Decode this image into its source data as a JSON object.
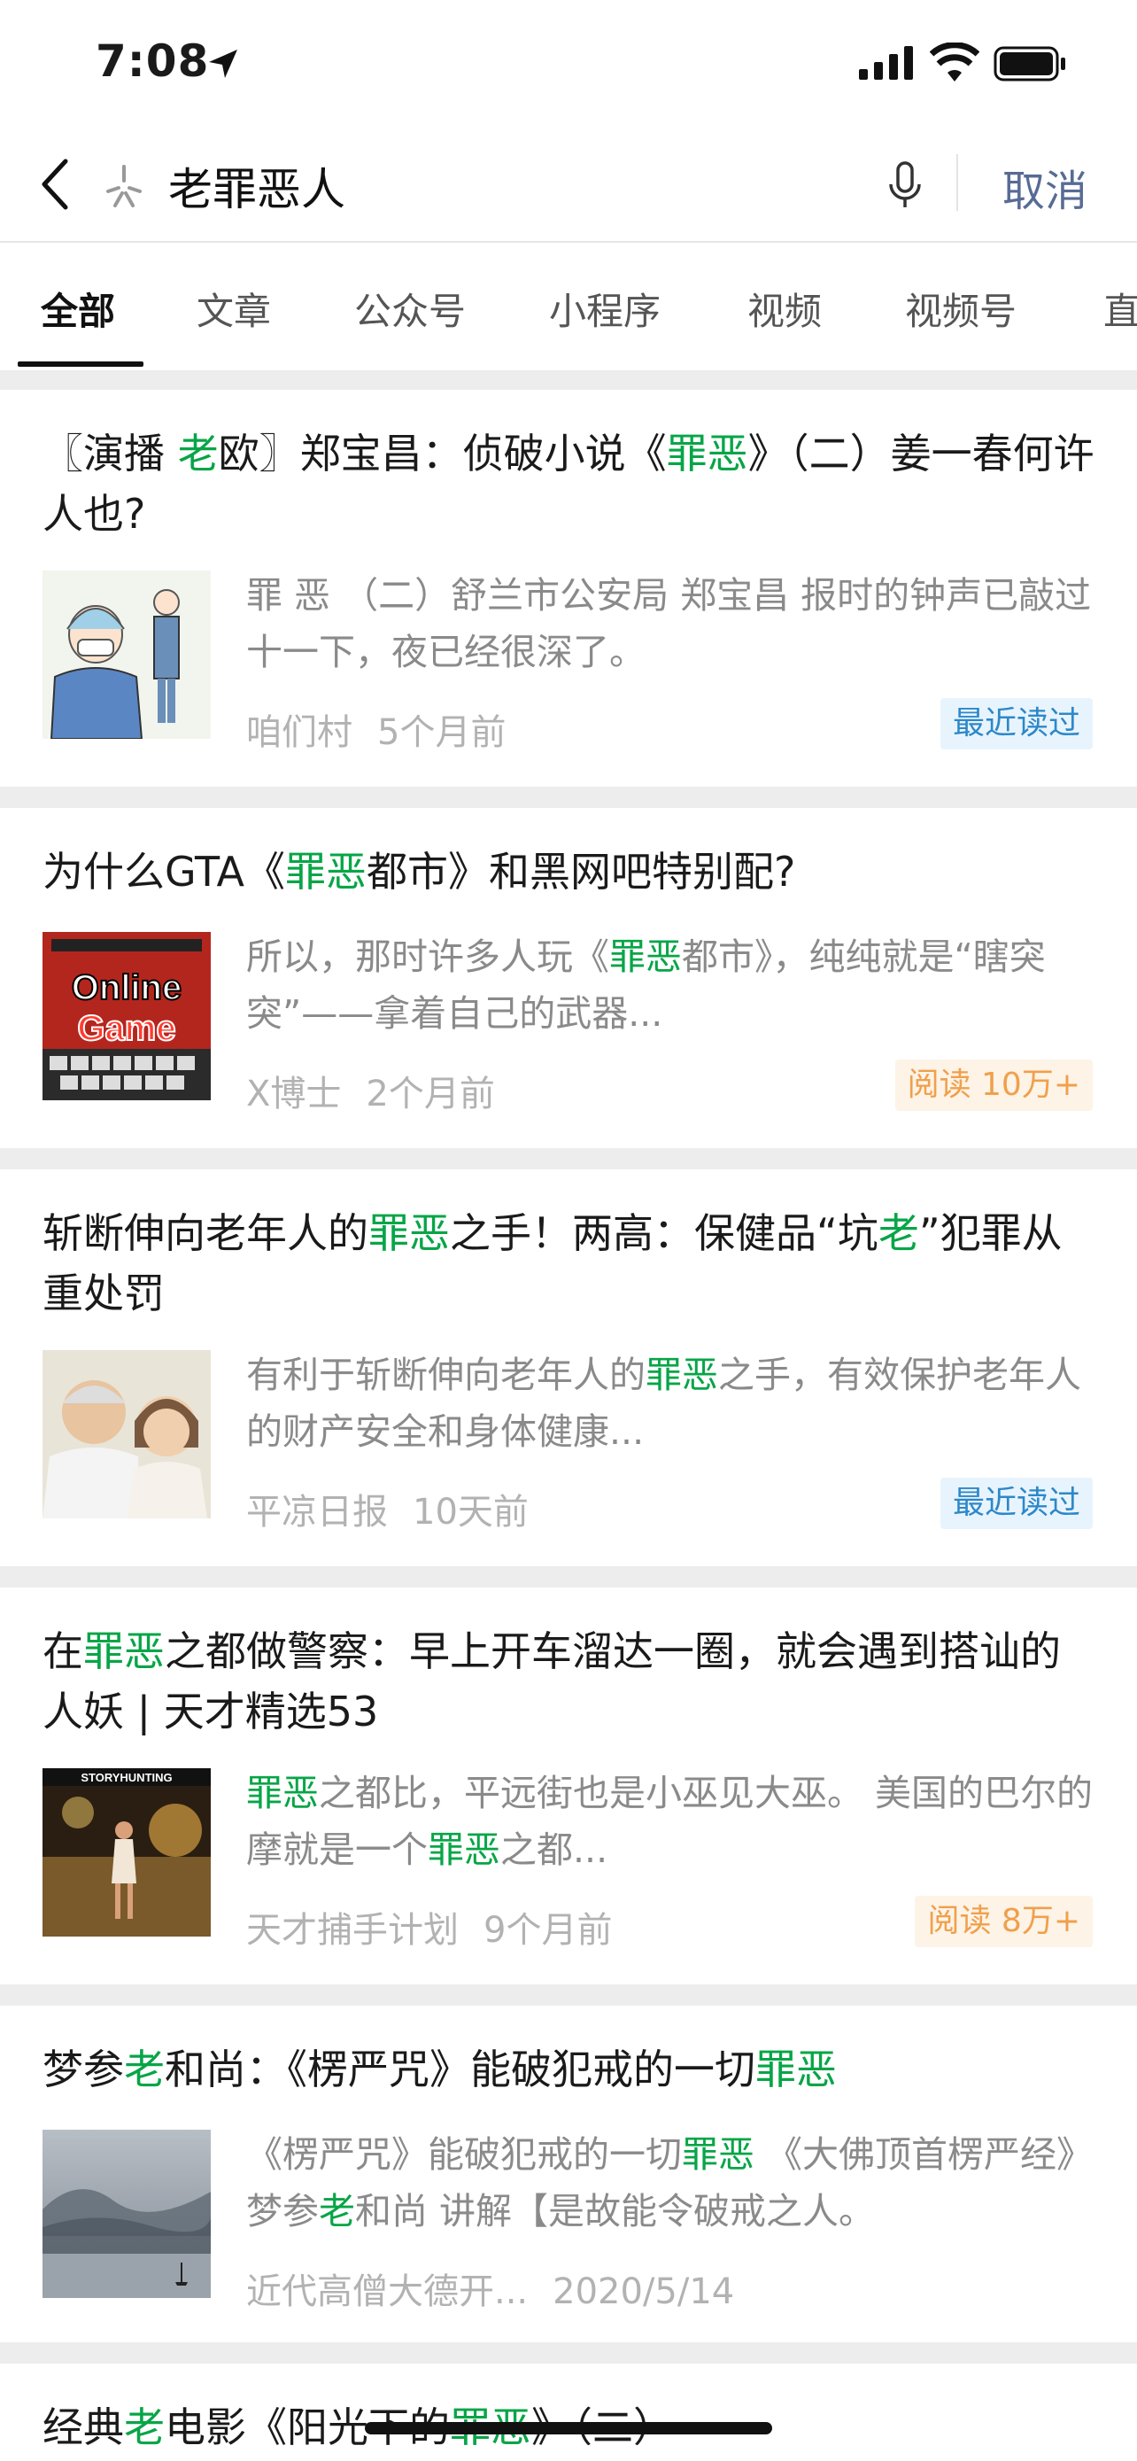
{
  "status_bar": {
    "time": "7:08"
  },
  "search": {
    "query": "老罪恶人",
    "cancel_label": "取消"
  },
  "tabs": [
    "全部",
    "文章",
    "公众号",
    "小程序",
    "视频",
    "视频号",
    "直"
  ],
  "results": [
    {
      "title_parts": [
        {
          "t": "〖演播 "
        },
        {
          "t": "老",
          "h": true
        },
        {
          "t": "欧〗郑宝昌：侦破小说《"
        },
        {
          "t": "罪恶",
          "h": true
        },
        {
          "t": "》（二）姜一春何许人也?"
        }
      ],
      "snippet_parts": [
        {
          "t": "罪 恶 （二）舒兰市公安局 郑宝昌 报时的钟声已敲过十一下，夜已经很深了。"
        }
      ],
      "source": "咱们村",
      "time": "5个月前",
      "badge": "最近读过",
      "badge_color": "#2d88c9"
    },
    {
      "title_parts": [
        {
          "t": "为什么GTA《"
        },
        {
          "t": "罪恶",
          "h": true
        },
        {
          "t": "都市》和黑网吧特别配?"
        }
      ],
      "snippet_parts": [
        {
          "t": "所以，那时许多人玩《"
        },
        {
          "t": "罪恶",
          "h": true
        },
        {
          "t": "都市》，纯纯就是“瞎突突”——拿着自己的武器..."
        }
      ],
      "source": "X博士",
      "time": "2个月前",
      "badge": "阅读 10万+",
      "badge_color": "#f0a04b",
      "thumb_text": [
        "Online",
        "Game"
      ]
    },
    {
      "title_parts": [
        {
          "t": "斩断伸向老年人的"
        },
        {
          "t": "罪恶",
          "h": true
        },
        {
          "t": "之手！两高：保健品“坑"
        },
        {
          "t": "老",
          "h": true
        },
        {
          "t": "”犯罪从重处罚"
        }
      ],
      "snippet_parts": [
        {
          "t": "有利于斩断伸向老年人的"
        },
        {
          "t": "罪恶",
          "h": true
        },
        {
          "t": "之手，有效保护老年人的财产安全和身体健康..."
        }
      ],
      "source": "平凉日报",
      "time": "10天前",
      "badge": "最近读过",
      "badge_color": "#2d88c9"
    },
    {
      "title_parts": [
        {
          "t": "在"
        },
        {
          "t": "罪恶",
          "h": true
        },
        {
          "t": "之都做警察：早上开车溜达一圈，就会遇到搭讪的人妖 | 天才精选53"
        }
      ],
      "snippet_parts": [
        {
          "t": "罪恶",
          "h": true
        },
        {
          "t": "之都比，平远街也是小巫见大巫。 美国的巴尔的摩就是一个"
        },
        {
          "t": "罪恶",
          "h": true
        },
        {
          "t": "之都..."
        }
      ],
      "source": "天才捕手计划",
      "time": "9个月前",
      "badge": "阅读 8万+",
      "badge_color": "#f0a04b",
      "thumb_text": [
        "STORYHUNTING"
      ]
    },
    {
      "title_parts": [
        {
          "t": "梦参"
        },
        {
          "t": "老",
          "h": true
        },
        {
          "t": "和尚：《楞严咒》能破犯戒的一切"
        },
        {
          "t": "罪恶",
          "h": true
        }
      ],
      "snippet_parts": [
        {
          "t": "《楞严咒》能破犯戒的一切"
        },
        {
          "t": "罪恶",
          "h": true
        },
        {
          "t": " 《大佛顶首楞严经》 梦参"
        },
        {
          "t": "老",
          "h": true
        },
        {
          "t": "和尚 讲解【是故能令破戒之人。"
        }
      ],
      "source": "近代高僧大德开...",
      "time": "2020/5/14",
      "badge": "",
      "badge_color": ""
    },
    {
      "title_parts": [
        {
          "t": "经典"
        },
        {
          "t": "老",
          "h": true
        },
        {
          "t": "电影《阳光下的"
        },
        {
          "t": "罪恶",
          "h": true
        },
        {
          "t": "》（二）"
        }
      ],
      "snippet_parts": [],
      "source": "",
      "time": "",
      "badge": "",
      "badge_color": ""
    }
  ]
}
